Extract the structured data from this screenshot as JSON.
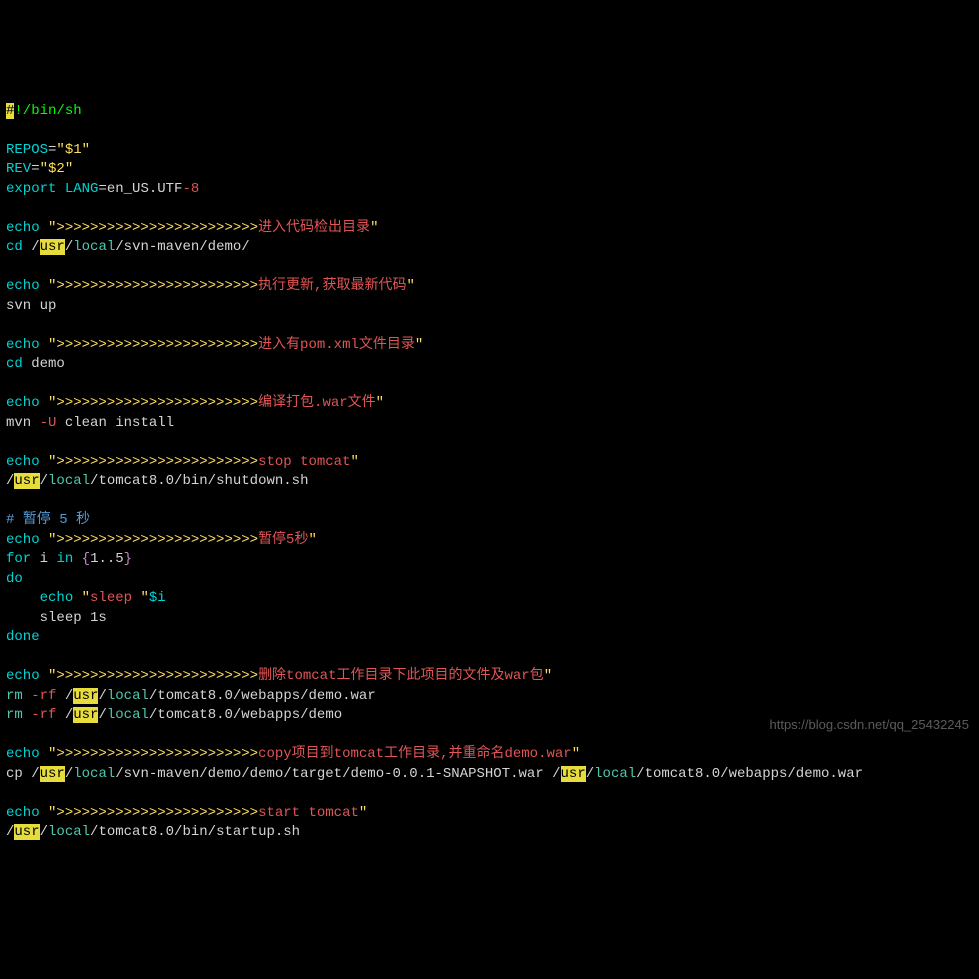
{
  "l1_shebang": "!/bin/sh",
  "l3_repos": "REPOS",
  "l3_eq": "=",
  "l3_val": "\"$1\"",
  "l4_rev": "REV",
  "l4_val": "\"$2\"",
  "l5_export": "export",
  "l5_lang": "LANG",
  "l5_enus": "en_US.UTF",
  "l5_8": "-8",
  "echo_kw": "echo",
  "arrows": ">>>>>>>>>>>>>>>>>>>>>>>>",
  "msg1": "进入代码检出目录",
  "cd": "cd",
  "usr": "usr",
  "local": "local",
  "path_svn_demo": "/svn-maven/demo/",
  "msg2": "执行更新,获取最新代码",
  "svn_up": "svn up",
  "msg3": "进入有pom.xml文件目录",
  "demo": "demo",
  "msg4": "编译打包.war文件",
  "mvn": "mvn",
  "U": "-U",
  "clean_install": "clean install",
  "msg5_stop": "stop tomcat",
  "tomcat_shutdown": "/tomcat8.0/bin/shutdown.sh",
  "pause_comment": "# 暂停 5 秒",
  "msg6": "暂停5秒",
  "for": "for",
  "i": "i",
  "in": "in",
  "range": "1..5",
  "do": "do",
  "sleep_str": "sleep ",
  "dollar_i": "$i",
  "sleep": "sleep",
  "1s": "1s",
  "done": "done",
  "msg7": "删除tomcat工作目录下此项目的文件及war包",
  "rm": "rm",
  "rf": "-rf",
  "tomcat_webapps_war": "/tomcat8.0/webapps/demo.war",
  "tomcat_webapps_demo": "/tomcat8.0/webapps/demo",
  "msg8": "copy项目到tomcat工作目录,并重命名demo.war",
  "cp": "cp /",
  "svn_target": "/svn-maven/demo/demo/target/demo-0.0.1-SNAPSHOT.war /",
  "tomcat_demowar": "/tomcat8.0/webapps/demo.war",
  "msg9_start": "start tomcat",
  "tomcat_startup": "/tomcat8.0/bin/startup.sh",
  "watermark": "https://blog.csdn.net/qq_25432245",
  "q": "\"",
  "slash": "/"
}
